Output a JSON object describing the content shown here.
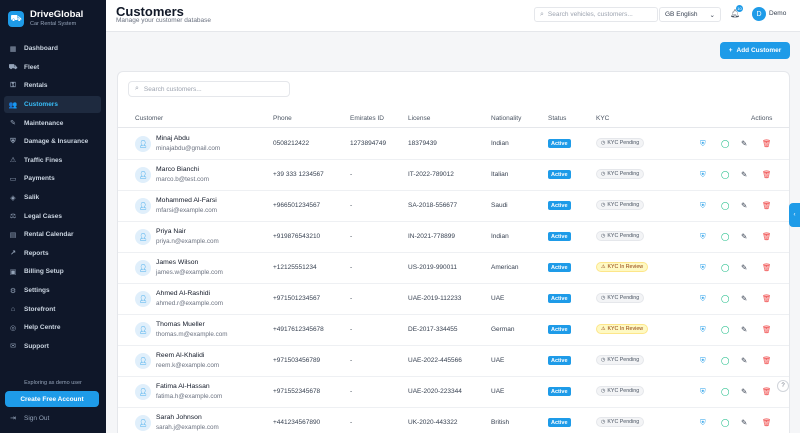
{
  "brand": {
    "name": "DriveGlobal",
    "subtitle": "Car Rental System"
  },
  "sidebar": {
    "items": [
      {
        "label": "Dashboard",
        "icon": "grid-icon",
        "glyph": "▦"
      },
      {
        "label": "Fleet",
        "icon": "car-icon",
        "glyph": "⛟"
      },
      {
        "label": "Rentals",
        "icon": "key-icon",
        "glyph": "⚿"
      },
      {
        "label": "Customers",
        "icon": "users-icon",
        "glyph": "👥",
        "active": true
      },
      {
        "label": "Maintenance",
        "icon": "wrench-icon",
        "glyph": "✎"
      },
      {
        "label": "Damage & Insurance",
        "icon": "shield-icon",
        "glyph": "⛨"
      },
      {
        "label": "Traffic Fines",
        "icon": "alert-icon",
        "glyph": "⚠"
      },
      {
        "label": "Payments",
        "icon": "card-icon",
        "glyph": "▭"
      },
      {
        "label": "Salik",
        "icon": "toll-icon",
        "glyph": "◈"
      },
      {
        "label": "Legal Cases",
        "icon": "scale-icon",
        "glyph": "⚖"
      },
      {
        "label": "Rental Calendar",
        "icon": "calendar-icon",
        "glyph": "▤"
      },
      {
        "label": "Reports",
        "icon": "chart-icon",
        "glyph": "↗"
      },
      {
        "label": "Billing Setup",
        "icon": "billing-icon",
        "glyph": "▣"
      },
      {
        "label": "Settings",
        "icon": "gear-icon",
        "glyph": "⚙"
      },
      {
        "label": "Storefront",
        "icon": "store-icon",
        "glyph": "⌂"
      },
      {
        "label": "Help Centre",
        "icon": "globe-icon",
        "glyph": "◎"
      },
      {
        "label": "Support",
        "icon": "chat-icon",
        "glyph": "✉"
      }
    ],
    "demo_note": "Exploring as demo user",
    "create_account": "Create Free Account",
    "sign_out": "Sign Out"
  },
  "header": {
    "title": "Customers",
    "subtitle": "Manage your customer database",
    "search_placeholder": "Search vehicles, customers...",
    "language": "GB English",
    "notification_count": "10",
    "user_initial": "D",
    "user_name": "Demo"
  },
  "actions": {
    "add_customer": "Add Customer"
  },
  "table": {
    "search_placeholder": "Search customers...",
    "columns": [
      "Customer",
      "Phone",
      "Emirates ID",
      "License",
      "Nationality",
      "Status",
      "KYC",
      "Actions"
    ],
    "rows": [
      {
        "name": "Minaj Abdu",
        "email": "minajabdu@gmail.com",
        "phone": "0508212422",
        "emirates_id": "1273894749",
        "license": "18379439",
        "nationality": "Indian",
        "status": "Active",
        "kyc": "KYC Pending"
      },
      {
        "name": "Marco Bianchi",
        "email": "marco.b@test.com",
        "phone": "+39 333 1234567",
        "emirates_id": "-",
        "license": "IT-2022-789012",
        "nationality": "Italian",
        "status": "Active",
        "kyc": "KYC Pending"
      },
      {
        "name": "Mohammed Al-Farsi",
        "email": "mfarsi@example.com",
        "phone": "+966501234567",
        "emirates_id": "-",
        "license": "SA-2018-556677",
        "nationality": "Saudi",
        "status": "Active",
        "kyc": "KYC Pending"
      },
      {
        "name": "Priya Nair",
        "email": "priya.n@example.com",
        "phone": "+919876543210",
        "emirates_id": "-",
        "license": "IN-2021-778899",
        "nationality": "Indian",
        "status": "Active",
        "kyc": "KYC Pending"
      },
      {
        "name": "James Wilson",
        "email": "james.w@example.com",
        "phone": "+12125551234",
        "emirates_id": "-",
        "license": "US-2019-990011",
        "nationality": "American",
        "status": "Active",
        "kyc": "KYC In Review"
      },
      {
        "name": "Ahmed Al-Rashidi",
        "email": "ahmed.r@example.com",
        "phone": "+971501234567",
        "emirates_id": "-",
        "license": "UAE-2019-112233",
        "nationality": "UAE",
        "status": "Active",
        "kyc": "KYC Pending"
      },
      {
        "name": "Thomas Mueller",
        "email": "thomas.m@example.com",
        "phone": "+4917612345678",
        "emirates_id": "-",
        "license": "DE-2017-334455",
        "nationality": "German",
        "status": "Active",
        "kyc": "KYC In Review"
      },
      {
        "name": "Reem Al-Khalidi",
        "email": "reem.k@example.com",
        "phone": "+971503456789",
        "emirates_id": "-",
        "license": "UAE-2022-445566",
        "nationality": "UAE",
        "status": "Active",
        "kyc": "KYC Pending"
      },
      {
        "name": "Fatima Al-Hassan",
        "email": "fatima.h@example.com",
        "phone": "+971552345678",
        "emirates_id": "-",
        "license": "UAE-2020-223344",
        "nationality": "UAE",
        "status": "Active",
        "kyc": "KYC Pending"
      },
      {
        "name": "Sarah Johnson",
        "email": "sarah.j@example.com",
        "phone": "+441234567890",
        "emirates_id": "-",
        "license": "UK-2020-443322",
        "nationality": "British",
        "status": "Active",
        "kyc": "KYC Pending"
      }
    ]
  },
  "colors": {
    "accent": "#1e9be8",
    "sidebar_bg": "#0f1729",
    "kyc_review_bg": "#fef9c3",
    "delete": "#ef4444",
    "chat": "#10b981"
  }
}
